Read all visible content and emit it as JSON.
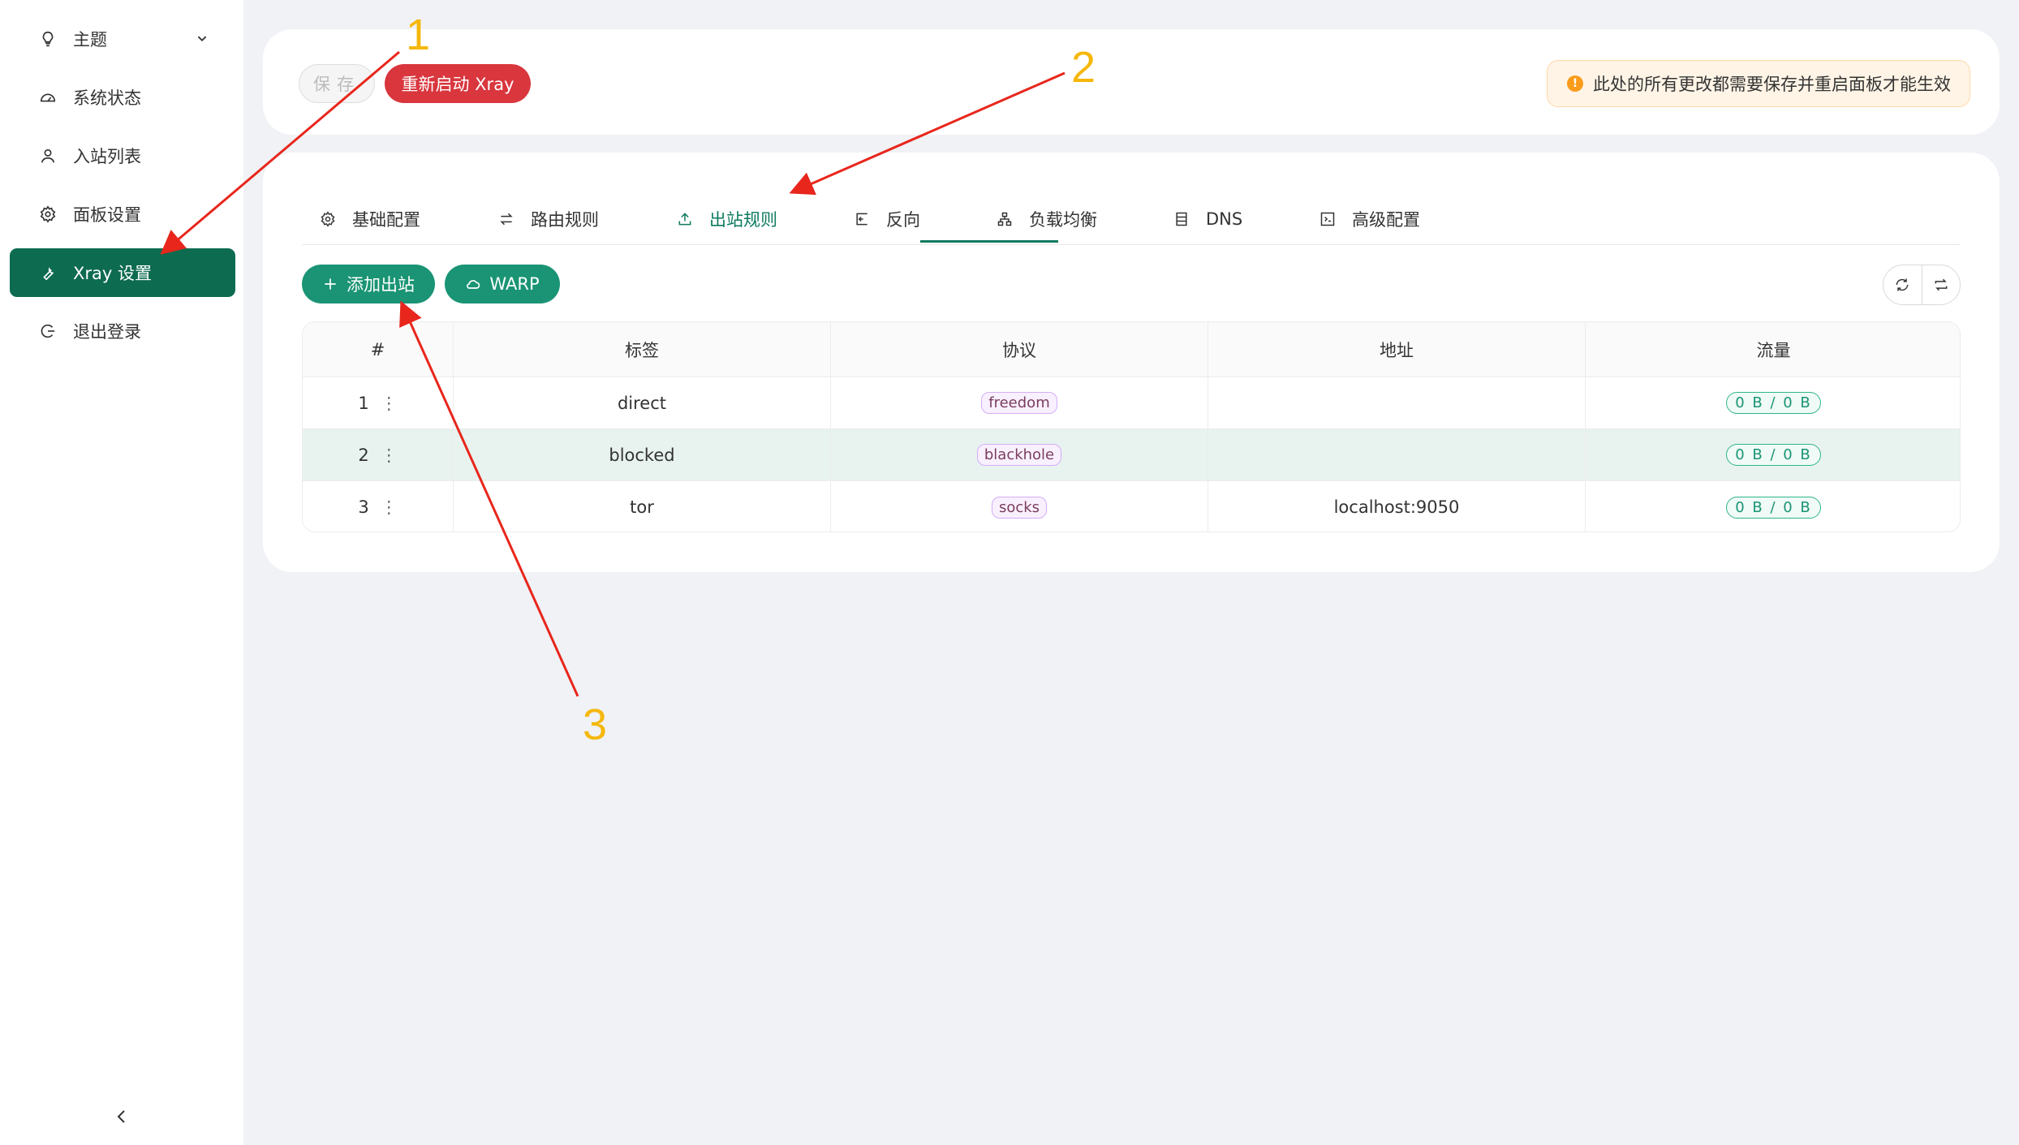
{
  "sidebar": {
    "items": [
      {
        "label": "主题",
        "icon": "bulb-icon"
      },
      {
        "label": "系统状态",
        "icon": "dashboard-icon"
      },
      {
        "label": "入站列表",
        "icon": "user-icon"
      },
      {
        "label": "面板设置",
        "icon": "gear-icon"
      },
      {
        "label": "Xray 设置",
        "icon": "tool-icon",
        "active": true
      },
      {
        "label": "退出登录",
        "icon": "logout-icon"
      }
    ]
  },
  "toolbar": {
    "save_label": "保存",
    "restart_label": "重新启动 Xray",
    "warning": "此处的所有更改都需要保存并重启面板才能生效"
  },
  "tabs": [
    {
      "label": "基础配置",
      "icon": "gear-icon"
    },
    {
      "label": "路由规则",
      "icon": "swap-icon"
    },
    {
      "label": "出站规则",
      "icon": "upload-icon",
      "active": true
    },
    {
      "label": "反向",
      "icon": "import-icon"
    },
    {
      "label": "负载均衡",
      "icon": "cluster-icon"
    },
    {
      "label": "DNS",
      "icon": "database-icon"
    },
    {
      "label": "高级配置",
      "icon": "code-icon"
    }
  ],
  "actions": {
    "add_label": "添加出站",
    "warp_label": "WARP"
  },
  "table": {
    "headers": [
      "#",
      "标签",
      "协议",
      "地址",
      "流量"
    ],
    "rows": [
      {
        "index": "1",
        "tag": "direct",
        "protocol": "freedom",
        "address": "",
        "traffic": "0 B / 0 B"
      },
      {
        "index": "2",
        "tag": "blocked",
        "protocol": "blackhole",
        "address": "",
        "traffic": "0 B / 0 B"
      },
      {
        "index": "3",
        "tag": "tor",
        "protocol": "socks",
        "address": "localhost:9050",
        "traffic": "0 B / 0 B"
      }
    ]
  },
  "annotations": [
    "1",
    "2",
    "3"
  ],
  "colors": {
    "accent": "#0d6b50",
    "button_green": "#1a9474",
    "danger": "#d9363e",
    "annotation": "#f5b70a",
    "arrow": "#e8261c"
  }
}
